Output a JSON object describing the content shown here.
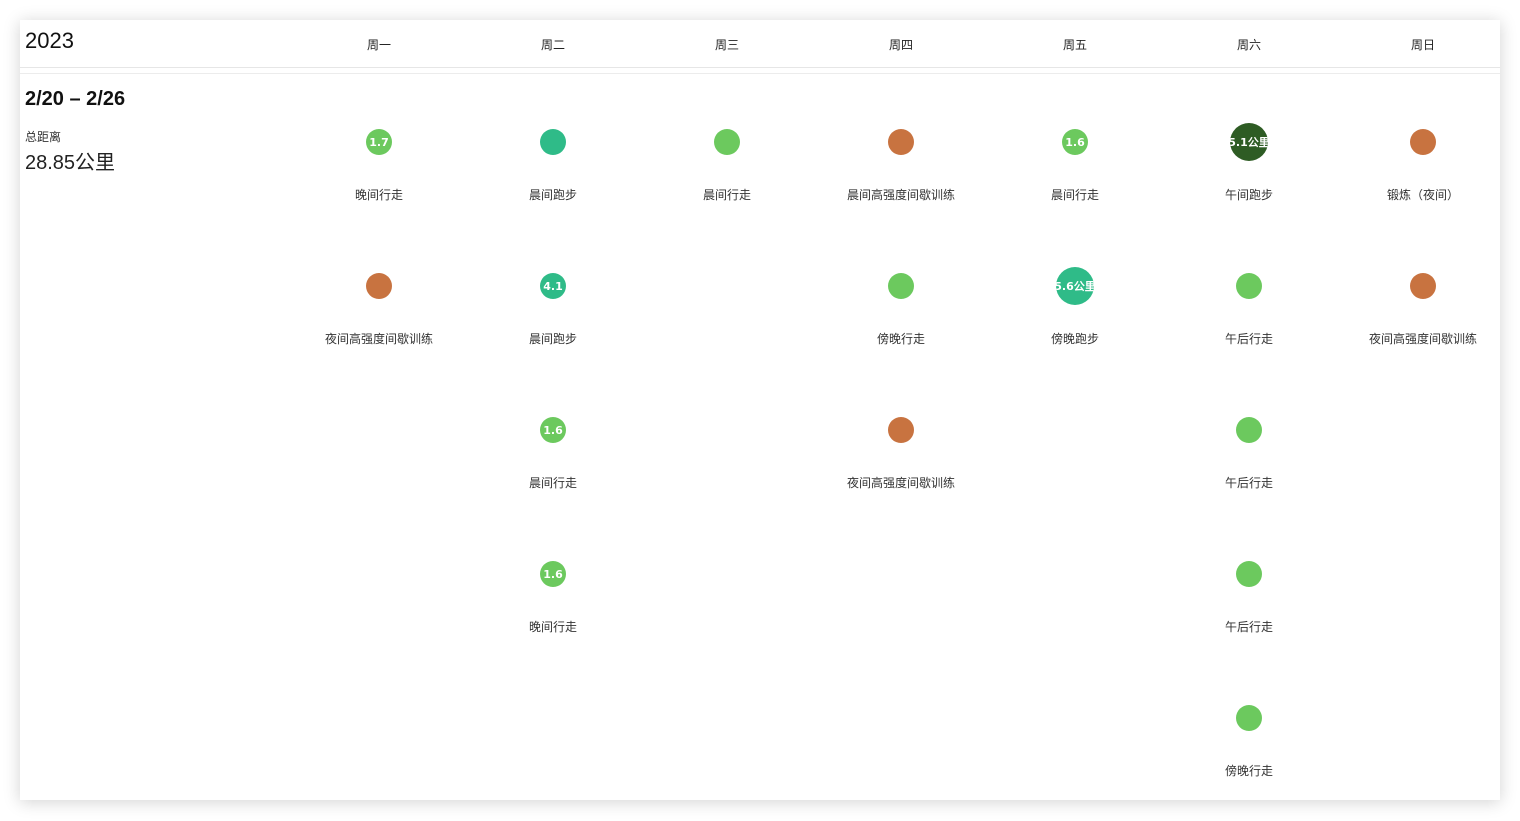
{
  "year": "2023",
  "days": [
    "周一",
    "周二",
    "周三",
    "周四",
    "周五",
    "周六",
    "周日"
  ],
  "week": {
    "range": "2/20 – 2/26",
    "distance_label": "总距离",
    "distance_value": "28.85公里"
  },
  "colors": {
    "walk": "#6cc95e",
    "run": "#2fbb88",
    "hiit": "#c87340",
    "run_long": "#2e5c24"
  },
  "activities": [
    [
      {
        "name": "晚间行走",
        "label": "1.7",
        "kind": "walk",
        "size": "medium"
      },
      {
        "name": "夜间高强度间歇训练",
        "label": "",
        "kind": "hiit",
        "size": "medium"
      }
    ],
    [
      {
        "name": "晨间跑步",
        "label": "",
        "kind": "run",
        "size": "medium"
      },
      {
        "name": "晨间跑步",
        "label": "4.1",
        "kind": "run",
        "size": "medium"
      },
      {
        "name": "晨间行走",
        "label": "1.6",
        "kind": "walk",
        "size": "medium"
      },
      {
        "name": "晚间行走",
        "label": "1.6",
        "kind": "walk",
        "size": "medium"
      }
    ],
    [
      {
        "name": "晨间行走",
        "label": "",
        "kind": "walk",
        "size": "medium"
      }
    ],
    [
      {
        "name": "晨间高强度间歇训练",
        "label": "",
        "kind": "hiit",
        "size": "medium"
      },
      {
        "name": "傍晚行走",
        "label": "",
        "kind": "walk",
        "size": "medium"
      },
      {
        "name": "夜间高强度间歇训练",
        "label": "",
        "kind": "hiit",
        "size": "medium"
      }
    ],
    [
      {
        "name": "晨间行走",
        "label": "1.6",
        "kind": "walk",
        "size": "medium"
      },
      {
        "name": "傍晚跑步",
        "label": "5.6公里",
        "kind": "run",
        "size": "large"
      }
    ],
    [
      {
        "name": "午间跑步",
        "label": "5.1公里",
        "kind": "run_long",
        "size": "large"
      },
      {
        "name": "午后行走",
        "label": "",
        "kind": "walk",
        "size": "medium"
      },
      {
        "name": "午后行走",
        "label": "",
        "kind": "walk",
        "size": "medium"
      },
      {
        "name": "午后行走",
        "label": "",
        "kind": "walk",
        "size": "medium"
      },
      {
        "name": "傍晚行走",
        "label": "",
        "kind": "walk",
        "size": "medium"
      }
    ],
    [
      {
        "name": "锻炼（夜间）",
        "label": "",
        "kind": "hiit",
        "size": "medium"
      },
      {
        "name": "夜间高强度间歇训练",
        "label": "",
        "kind": "hiit",
        "size": "medium"
      }
    ]
  ]
}
